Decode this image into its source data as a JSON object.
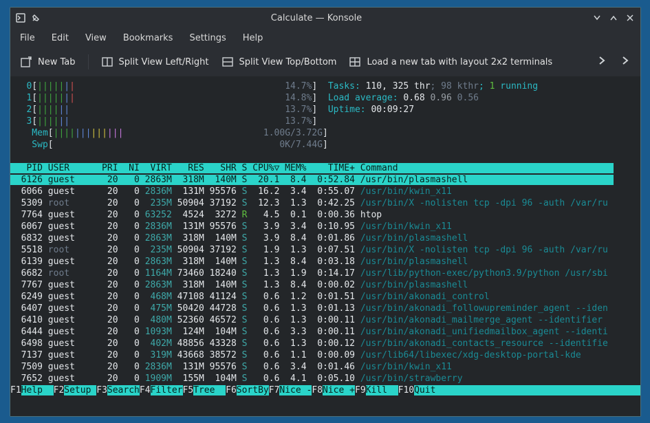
{
  "window": {
    "title": "Calculate — Konsole"
  },
  "menus": [
    "File",
    "Edit",
    "View",
    "Bookmarks",
    "Settings",
    "Help"
  ],
  "toolbar": {
    "newtab": "New Tab",
    "splitlr": "Split View Left/Right",
    "splittb": "Split View Top/Bottom",
    "layout": "Load a new tab with layout 2x2 terminals"
  },
  "meters": {
    "cpu": [
      {
        "id": "0",
        "pct": "14.7%"
      },
      {
        "id": "1",
        "pct": "14.8%"
      },
      {
        "id": "2",
        "pct": "13.7%"
      },
      {
        "id": "3",
        "pct": "13.7%"
      }
    ],
    "mem": {
      "used": "1.00G",
      "total": "3.72G"
    },
    "swp": {
      "used": "0K",
      "total": "7.44G"
    },
    "tasks": {
      "total": "110",
      "thr": "325",
      "kthr": "98",
      "running": "1"
    },
    "load": [
      "0.68",
      "0.96",
      "0.56"
    ],
    "uptime": "00:09:27"
  },
  "header": {
    "pid": "PID",
    "user": "USER",
    "pri": "PRI",
    "ni": "NI",
    "virt": "VIRT",
    "res": "RES",
    "shr": "SHR",
    "s": "S",
    "cpu": "CPU%",
    "mem": "MEM%",
    "time": "TIME+",
    "cmd": "Command"
  },
  "rows": [
    {
      "pid": "6126",
      "user": "guest",
      "pri": "20",
      "ni": "0",
      "virt": "2863M",
      "res": "318M",
      "shr": "140M",
      "s": "S",
      "cpu": "20.1",
      "mem": "8.4",
      "time": "0:52.84",
      "cmd": "/usr/bin/plasmashell",
      "sel": true
    },
    {
      "pid": "6066",
      "user": "guest",
      "pri": "20",
      "ni": "0",
      "virt": "2836M",
      "res": "131M",
      "shr": "95576",
      "s": "S",
      "cpu": "16.2",
      "mem": "3.4",
      "time": "0:55.07",
      "cmd": "/usr/bin/kwin_x11"
    },
    {
      "pid": "5309",
      "user": "root",
      "pri": "20",
      "ni": "0",
      "virt": "235M",
      "res": "50904",
      "shr": "37192",
      "s": "S",
      "cpu": "12.3",
      "mem": "1.3",
      "time": "0:42.25",
      "cmd": "/usr/bin/X -nolisten tcp -dpi 96 -auth /var/ru",
      "root": true
    },
    {
      "pid": "7764",
      "user": "guest",
      "pri": "20",
      "ni": "0",
      "virt": "63252",
      "res": "4524",
      "shr": "3272",
      "s": "R",
      "cpu": "4.5",
      "mem": "0.1",
      "time": "0:00.36",
      "cmd": "htop",
      "running": true,
      "local": true
    },
    {
      "pid": "6067",
      "user": "guest",
      "pri": "20",
      "ni": "0",
      "virt": "2836M",
      "res": "131M",
      "shr": "95576",
      "s": "S",
      "cpu": "3.9",
      "mem": "3.4",
      "time": "0:10.95",
      "cmd": "/usr/bin/kwin_x11"
    },
    {
      "pid": "6832",
      "user": "guest",
      "pri": "20",
      "ni": "0",
      "virt": "2863M",
      "res": "318M",
      "shr": "140M",
      "s": "S",
      "cpu": "3.9",
      "mem": "8.4",
      "time": "0:01.86",
      "cmd": "/usr/bin/plasmashell"
    },
    {
      "pid": "5518",
      "user": "root",
      "pri": "20",
      "ni": "0",
      "virt": "235M",
      "res": "50904",
      "shr": "37192",
      "s": "S",
      "cpu": "1.9",
      "mem": "1.3",
      "time": "0:07.51",
      "cmd": "/usr/bin/X -nolisten tcp -dpi 96 -auth /var/ru",
      "root": true
    },
    {
      "pid": "6139",
      "user": "guest",
      "pri": "20",
      "ni": "0",
      "virt": "2863M",
      "res": "318M",
      "shr": "140M",
      "s": "S",
      "cpu": "1.3",
      "mem": "8.4",
      "time": "0:03.18",
      "cmd": "/usr/bin/plasmashell"
    },
    {
      "pid": "6682",
      "user": "root",
      "pri": "20",
      "ni": "0",
      "virt": "1164M",
      "res": "73460",
      "shr": "18240",
      "s": "S",
      "cpu": "1.3",
      "mem": "1.9",
      "time": "0:14.17",
      "cmd": "/usr/lib/python-exec/python3.9/python /usr/sbi",
      "root": true
    },
    {
      "pid": "7767",
      "user": "guest",
      "pri": "20",
      "ni": "0",
      "virt": "2863M",
      "res": "318M",
      "shr": "140M",
      "s": "S",
      "cpu": "1.3",
      "mem": "8.4",
      "time": "0:00.02",
      "cmd": "/usr/bin/plasmashell"
    },
    {
      "pid": "6249",
      "user": "guest",
      "pri": "20",
      "ni": "0",
      "virt": "468M",
      "res": "47108",
      "shr": "41124",
      "s": "S",
      "cpu": "0.6",
      "mem": "1.2",
      "time": "0:01.51",
      "cmd": "/usr/bin/akonadi_control"
    },
    {
      "pid": "6407",
      "user": "guest",
      "pri": "20",
      "ni": "0",
      "virt": "475M",
      "res": "50420",
      "shr": "44728",
      "s": "S",
      "cpu": "0.6",
      "mem": "1.3",
      "time": "0:01.13",
      "cmd": "/usr/bin/akonadi_followupreminder_agent --iden"
    },
    {
      "pid": "6410",
      "user": "guest",
      "pri": "20",
      "ni": "0",
      "virt": "480M",
      "res": "52360",
      "shr": "46572",
      "s": "S",
      "cpu": "0.6",
      "mem": "1.3",
      "time": "0:00.11",
      "cmd": "/usr/bin/akonadi_mailmerge_agent --identifier "
    },
    {
      "pid": "6444",
      "user": "guest",
      "pri": "20",
      "ni": "0",
      "virt": "1093M",
      "res": "124M",
      "shr": "104M",
      "s": "S",
      "cpu": "0.6",
      "mem": "3.3",
      "time": "0:00.11",
      "cmd": "/usr/bin/akonadi_unifiedmailbox_agent --identi"
    },
    {
      "pid": "6498",
      "user": "guest",
      "pri": "20",
      "ni": "0",
      "virt": "402M",
      "res": "48856",
      "shr": "43328",
      "s": "S",
      "cpu": "0.6",
      "mem": "1.3",
      "time": "0:00.12",
      "cmd": "/usr/bin/akonadi_contacts_resource --identifie"
    },
    {
      "pid": "7137",
      "user": "guest",
      "pri": "20",
      "ni": "0",
      "virt": "319M",
      "res": "43668",
      "shr": "38572",
      "s": "S",
      "cpu": "0.6",
      "mem": "1.1",
      "time": "0:00.09",
      "cmd": "/usr/lib64/libexec/xdg-desktop-portal-kde"
    },
    {
      "pid": "7509",
      "user": "guest",
      "pri": "20",
      "ni": "0",
      "virt": "2836M",
      "res": "131M",
      "shr": "95576",
      "s": "S",
      "cpu": "0.6",
      "mem": "3.4",
      "time": "0:01.46",
      "cmd": "/usr/bin/kwin_x11"
    },
    {
      "pid": "7652",
      "user": "guest",
      "pri": "20",
      "ni": "0",
      "virt": "1909M",
      "res": "155M",
      "shr": "104M",
      "s": "S",
      "cpu": "0.6",
      "mem": "4.1",
      "time": "0:05.10",
      "cmd": "/usr/bin/strawberry"
    }
  ],
  "footer": [
    {
      "k": "F1",
      "l": "Help"
    },
    {
      "k": "F2",
      "l": "Setup"
    },
    {
      "k": "F3",
      "l": "Search"
    },
    {
      "k": "F4",
      "l": "Filter"
    },
    {
      "k": "F5",
      "l": "Tree"
    },
    {
      "k": "F6",
      "l": "SortBy"
    },
    {
      "k": "F7",
      "l": "Nice -"
    },
    {
      "k": "F8",
      "l": "Nice +"
    },
    {
      "k": "F9",
      "l": "Kill"
    },
    {
      "k": "F10",
      "l": "Quit"
    }
  ]
}
